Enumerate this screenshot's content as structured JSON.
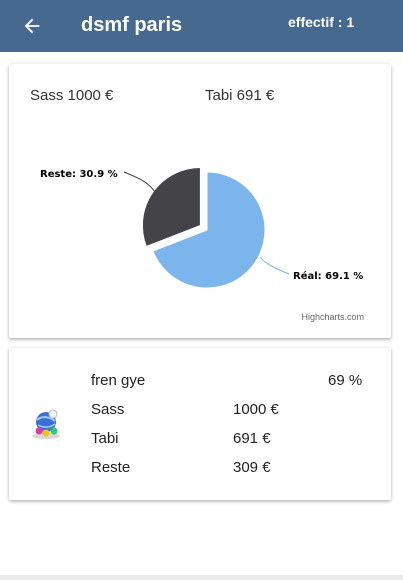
{
  "header": {
    "title": "dsmf paris",
    "effectif": "effectif : 1",
    "background": "#46698f"
  },
  "summary": {
    "sass": "Sass 1000 €",
    "tabi": "Tabi 691 €"
  },
  "chart_data": {
    "type": "pie",
    "slices": [
      {
        "label": "Réal: 69.1 %",
        "value": 69.1,
        "color": "#7cb5ec"
      },
      {
        "label": "Reste: 30.9 %",
        "value": 30.9,
        "color": "#434348"
      }
    ],
    "credits": "Highcharts.com"
  },
  "detail": {
    "icon": "globe-app-icon",
    "name": "fren gye",
    "percent": "69 %",
    "rows": [
      {
        "label": "Sass",
        "value": "1000 €"
      },
      {
        "label": "Tabi",
        "value": "691 €"
      },
      {
        "label": "Reste",
        "value": "309 €"
      }
    ]
  }
}
